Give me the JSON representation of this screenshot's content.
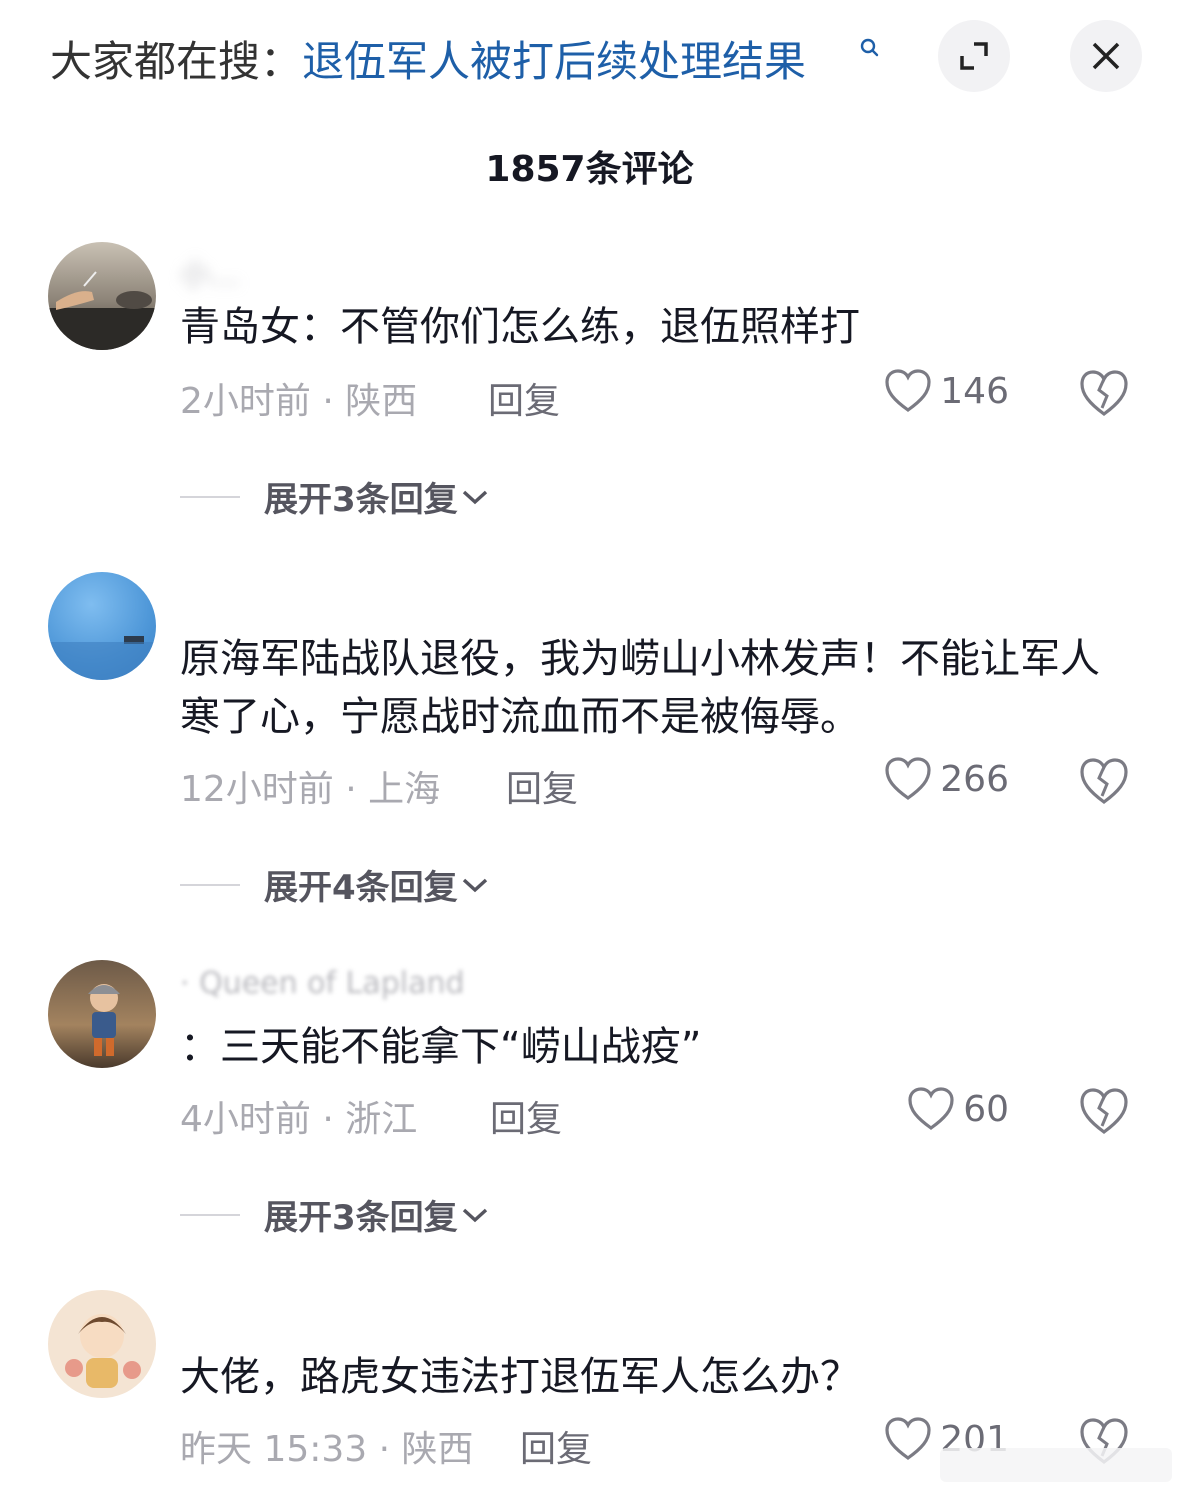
{
  "search": {
    "prefix": "大家都在搜：",
    "term": "退伍军人被打后续处理结果"
  },
  "header": {
    "count_title": "1857条评论"
  },
  "comments": [
    {
      "user": "小…",
      "text": "青岛女：不管你们怎么练，退伍照样打",
      "meta": "2小时前 · 陕西",
      "reply": "回复",
      "likes": "146",
      "expand": "展开3条回复"
    },
    {
      "user": "",
      "text": "原海军陆战队退役，我为崂山小林发声！不能让军人寒了心，宁愿战时流血而不是被侮辱。",
      "meta": "12小时前 · 上海",
      "reply": "回复",
      "likes": "266",
      "expand": "展开4条回复"
    },
    {
      "user": "· Queen of Lapland",
      "text": "：三天能不能拿下“崂山战疫”",
      "meta": "4小时前 · 浙江",
      "reply": "回复",
      "likes": "60",
      "expand": "展开3条回复"
    },
    {
      "user": "",
      "text": "大佬，路虎女违法打退伍军人怎么办？",
      "meta": "昨天 15:33 · 陕西",
      "reply": "回复",
      "likes": "201",
      "expand": ""
    }
  ],
  "colors": {
    "link": "#1e5fa8",
    "text": "#161823",
    "meta": "#a9a9b0"
  }
}
